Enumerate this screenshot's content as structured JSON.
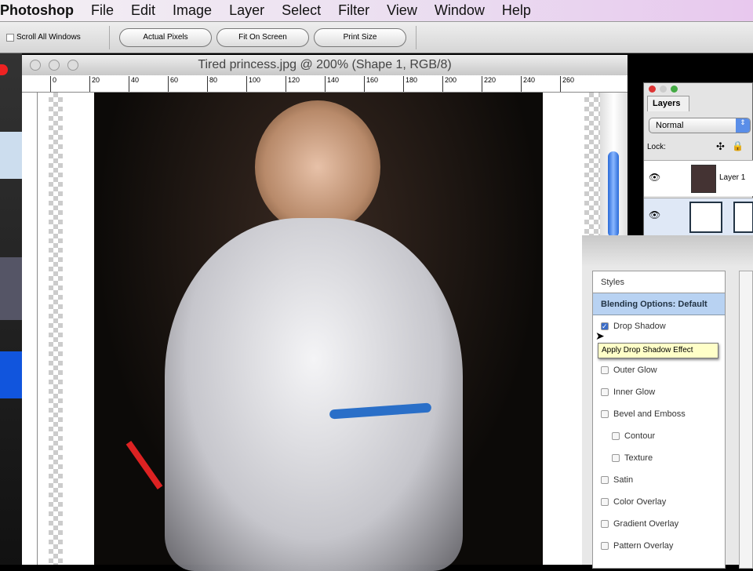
{
  "menubar": {
    "app": "Photoshop",
    "items": [
      "File",
      "Edit",
      "Image",
      "Layer",
      "Select",
      "Filter",
      "View",
      "Window",
      "Help"
    ]
  },
  "options": {
    "scroll_all": "Scroll All Windows",
    "actual_pixels": "Actual Pixels",
    "fit_on_screen": "Fit On Screen",
    "print_size": "Print Size"
  },
  "document": {
    "title": "Tired princess.jpg @ 200% (Shape 1, RGB/8)",
    "ruler_labels": [
      "0",
      "20",
      "40",
      "60",
      "80",
      "100",
      "120",
      "140",
      "160",
      "180",
      "200",
      "220",
      "240",
      "260"
    ]
  },
  "layers": {
    "tab": "Layers",
    "blend_mode": "Normal",
    "lock_label": "Lock:",
    "layer1": "Layer 1"
  },
  "layer_style": {
    "styles_header": "Styles",
    "blending": "Blending Options: Default",
    "items": [
      {
        "label": "Drop Shadow",
        "checked": true
      },
      {
        "label": "Outer Glow"
      },
      {
        "label": "Inner Glow"
      },
      {
        "label": "Bevel and Emboss"
      },
      {
        "label": "Contour",
        "sub": true
      },
      {
        "label": "Texture",
        "sub": true
      },
      {
        "label": "Satin"
      },
      {
        "label": "Color Overlay"
      },
      {
        "label": "Gradient Overlay"
      },
      {
        "label": "Pattern Overlay"
      }
    ],
    "tooltip": "Apply Drop Shadow Effect"
  }
}
